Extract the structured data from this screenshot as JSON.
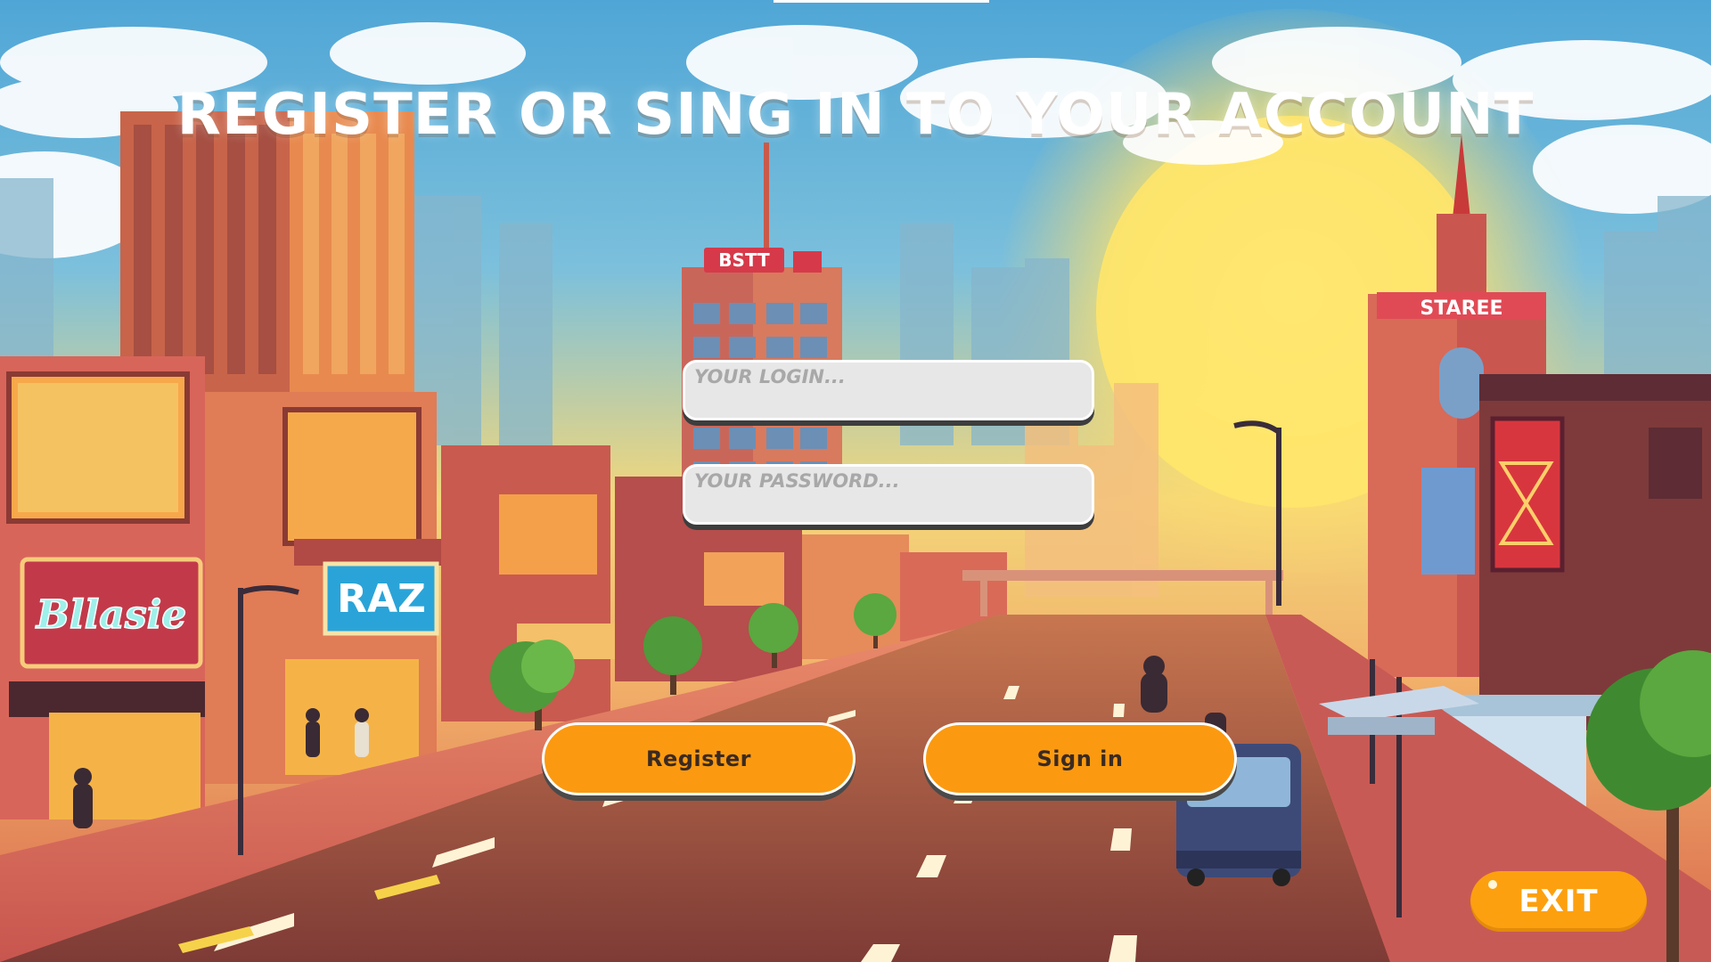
{
  "title": "Register or sing in to your account",
  "login": {
    "placeholder": "YOUR LOGIN...",
    "value": ""
  },
  "password": {
    "placeholder": "YOUR PASSWORD...",
    "value": ""
  },
  "buttons": {
    "register": "Register",
    "sign_in": "Sign in",
    "exit": "EXIT"
  },
  "scene_signs": {
    "tower_sign": "BSTT",
    "right_building_sign": "STAREE",
    "shop_sign_left": "Bllasie",
    "shop_sign_raz": "RAZ"
  },
  "colors": {
    "button_orange": "#fb9a10",
    "exit_orange": "#fca010",
    "field_bg": "#e7e7e7",
    "title_white": "#ffffff"
  }
}
